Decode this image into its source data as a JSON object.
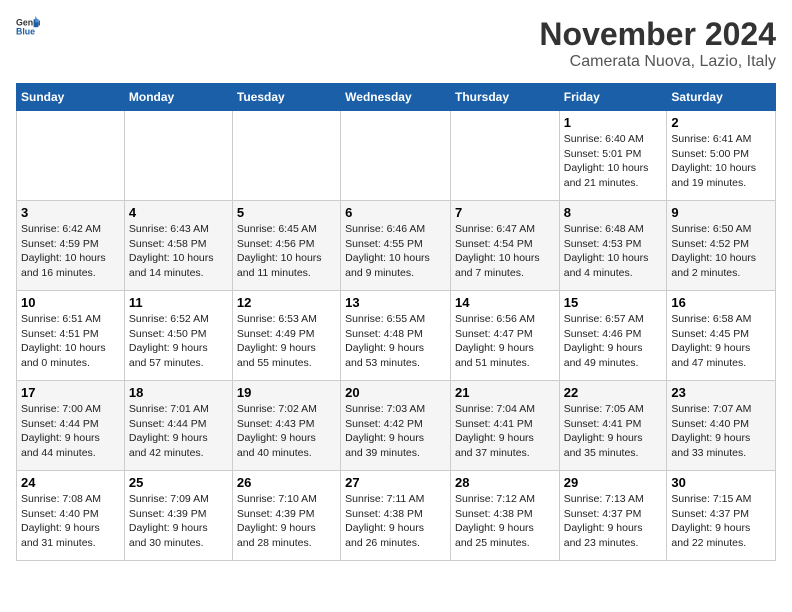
{
  "header": {
    "logo_general": "General",
    "logo_blue": "Blue",
    "month": "November 2024",
    "location": "Camerata Nuova, Lazio, Italy"
  },
  "weekdays": [
    "Sunday",
    "Monday",
    "Tuesday",
    "Wednesday",
    "Thursday",
    "Friday",
    "Saturday"
  ],
  "weeks": [
    [
      {
        "day": "",
        "info": ""
      },
      {
        "day": "",
        "info": ""
      },
      {
        "day": "",
        "info": ""
      },
      {
        "day": "",
        "info": ""
      },
      {
        "day": "",
        "info": ""
      },
      {
        "day": "1",
        "info": "Sunrise: 6:40 AM\nSunset: 5:01 PM\nDaylight: 10 hours\nand 21 minutes."
      },
      {
        "day": "2",
        "info": "Sunrise: 6:41 AM\nSunset: 5:00 PM\nDaylight: 10 hours\nand 19 minutes."
      }
    ],
    [
      {
        "day": "3",
        "info": "Sunrise: 6:42 AM\nSunset: 4:59 PM\nDaylight: 10 hours\nand 16 minutes."
      },
      {
        "day": "4",
        "info": "Sunrise: 6:43 AM\nSunset: 4:58 PM\nDaylight: 10 hours\nand 14 minutes."
      },
      {
        "day": "5",
        "info": "Sunrise: 6:45 AM\nSunset: 4:56 PM\nDaylight: 10 hours\nand 11 minutes."
      },
      {
        "day": "6",
        "info": "Sunrise: 6:46 AM\nSunset: 4:55 PM\nDaylight: 10 hours\nand 9 minutes."
      },
      {
        "day": "7",
        "info": "Sunrise: 6:47 AM\nSunset: 4:54 PM\nDaylight: 10 hours\nand 7 minutes."
      },
      {
        "day": "8",
        "info": "Sunrise: 6:48 AM\nSunset: 4:53 PM\nDaylight: 10 hours\nand 4 minutes."
      },
      {
        "day": "9",
        "info": "Sunrise: 6:50 AM\nSunset: 4:52 PM\nDaylight: 10 hours\nand 2 minutes."
      }
    ],
    [
      {
        "day": "10",
        "info": "Sunrise: 6:51 AM\nSunset: 4:51 PM\nDaylight: 10 hours\nand 0 minutes."
      },
      {
        "day": "11",
        "info": "Sunrise: 6:52 AM\nSunset: 4:50 PM\nDaylight: 9 hours\nand 57 minutes."
      },
      {
        "day": "12",
        "info": "Sunrise: 6:53 AM\nSunset: 4:49 PM\nDaylight: 9 hours\nand 55 minutes."
      },
      {
        "day": "13",
        "info": "Sunrise: 6:55 AM\nSunset: 4:48 PM\nDaylight: 9 hours\nand 53 minutes."
      },
      {
        "day": "14",
        "info": "Sunrise: 6:56 AM\nSunset: 4:47 PM\nDaylight: 9 hours\nand 51 minutes."
      },
      {
        "day": "15",
        "info": "Sunrise: 6:57 AM\nSunset: 4:46 PM\nDaylight: 9 hours\nand 49 minutes."
      },
      {
        "day": "16",
        "info": "Sunrise: 6:58 AM\nSunset: 4:45 PM\nDaylight: 9 hours\nand 47 minutes."
      }
    ],
    [
      {
        "day": "17",
        "info": "Sunrise: 7:00 AM\nSunset: 4:44 PM\nDaylight: 9 hours\nand 44 minutes."
      },
      {
        "day": "18",
        "info": "Sunrise: 7:01 AM\nSunset: 4:44 PM\nDaylight: 9 hours\nand 42 minutes."
      },
      {
        "day": "19",
        "info": "Sunrise: 7:02 AM\nSunset: 4:43 PM\nDaylight: 9 hours\nand 40 minutes."
      },
      {
        "day": "20",
        "info": "Sunrise: 7:03 AM\nSunset: 4:42 PM\nDaylight: 9 hours\nand 39 minutes."
      },
      {
        "day": "21",
        "info": "Sunrise: 7:04 AM\nSunset: 4:41 PM\nDaylight: 9 hours\nand 37 minutes."
      },
      {
        "day": "22",
        "info": "Sunrise: 7:05 AM\nSunset: 4:41 PM\nDaylight: 9 hours\nand 35 minutes."
      },
      {
        "day": "23",
        "info": "Sunrise: 7:07 AM\nSunset: 4:40 PM\nDaylight: 9 hours\nand 33 minutes."
      }
    ],
    [
      {
        "day": "24",
        "info": "Sunrise: 7:08 AM\nSunset: 4:40 PM\nDaylight: 9 hours\nand 31 minutes."
      },
      {
        "day": "25",
        "info": "Sunrise: 7:09 AM\nSunset: 4:39 PM\nDaylight: 9 hours\nand 30 minutes."
      },
      {
        "day": "26",
        "info": "Sunrise: 7:10 AM\nSunset: 4:39 PM\nDaylight: 9 hours\nand 28 minutes."
      },
      {
        "day": "27",
        "info": "Sunrise: 7:11 AM\nSunset: 4:38 PM\nDaylight: 9 hours\nand 26 minutes."
      },
      {
        "day": "28",
        "info": "Sunrise: 7:12 AM\nSunset: 4:38 PM\nDaylight: 9 hours\nand 25 minutes."
      },
      {
        "day": "29",
        "info": "Sunrise: 7:13 AM\nSunset: 4:37 PM\nDaylight: 9 hours\nand 23 minutes."
      },
      {
        "day": "30",
        "info": "Sunrise: 7:15 AM\nSunset: 4:37 PM\nDaylight: 9 hours\nand 22 minutes."
      }
    ]
  ]
}
